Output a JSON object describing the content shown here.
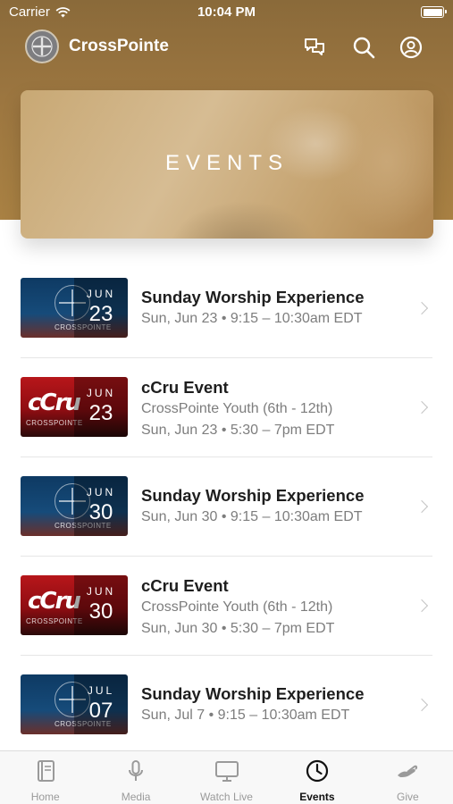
{
  "status": {
    "carrier": "Carrier",
    "time": "10:04 PM"
  },
  "header": {
    "title": "CrossPointe"
  },
  "banner": {
    "title": "EVENTS"
  },
  "events": [
    {
      "type": "worship",
      "title": "Sunday Worship Experience",
      "line1": "Sun, Jun 23 • 9:15 – 10:30am EDT",
      "line2": "",
      "month": "JUN",
      "day": "23"
    },
    {
      "type": "cru",
      "title": "cCru Event",
      "line1": "CrossPointe Youth (6th - 12th)",
      "line2": "Sun, Jun 23 • 5:30 – 7pm EDT",
      "month": "JUN",
      "day": "23"
    },
    {
      "type": "worship",
      "title": "Sunday Worship Experience",
      "line1": "Sun, Jun 30 • 9:15 – 10:30am EDT",
      "line2": "",
      "month": "JUN",
      "day": "30"
    },
    {
      "type": "cru",
      "title": "cCru Event",
      "line1": "CrossPointe Youth (6th - 12th)",
      "line2": "Sun, Jun 30 • 5:30 – 7pm EDT",
      "month": "JUN",
      "day": "30"
    },
    {
      "type": "worship",
      "title": "Sunday Worship Experience",
      "line1": "Sun, Jul 7 • 9:15 – 10:30am EDT",
      "line2": "",
      "month": "JUL",
      "day": "07"
    }
  ],
  "thumb_text": {
    "cru_logo": "cCru",
    "crosspointe": "CROSSPOINTE"
  },
  "tabs": [
    {
      "label": "Home",
      "icon": "book-icon",
      "active": false
    },
    {
      "label": "Media",
      "icon": "microphone-icon",
      "active": false
    },
    {
      "label": "Watch Live",
      "icon": "monitor-icon",
      "active": false
    },
    {
      "label": "Events",
      "icon": "clock-icon",
      "active": true
    },
    {
      "label": "Give",
      "icon": "hand-icon",
      "active": false
    }
  ],
  "colors": {
    "header_brown": "#9c7640",
    "active_tab": "#111111",
    "inactive_tab": "#9a9a9a"
  }
}
